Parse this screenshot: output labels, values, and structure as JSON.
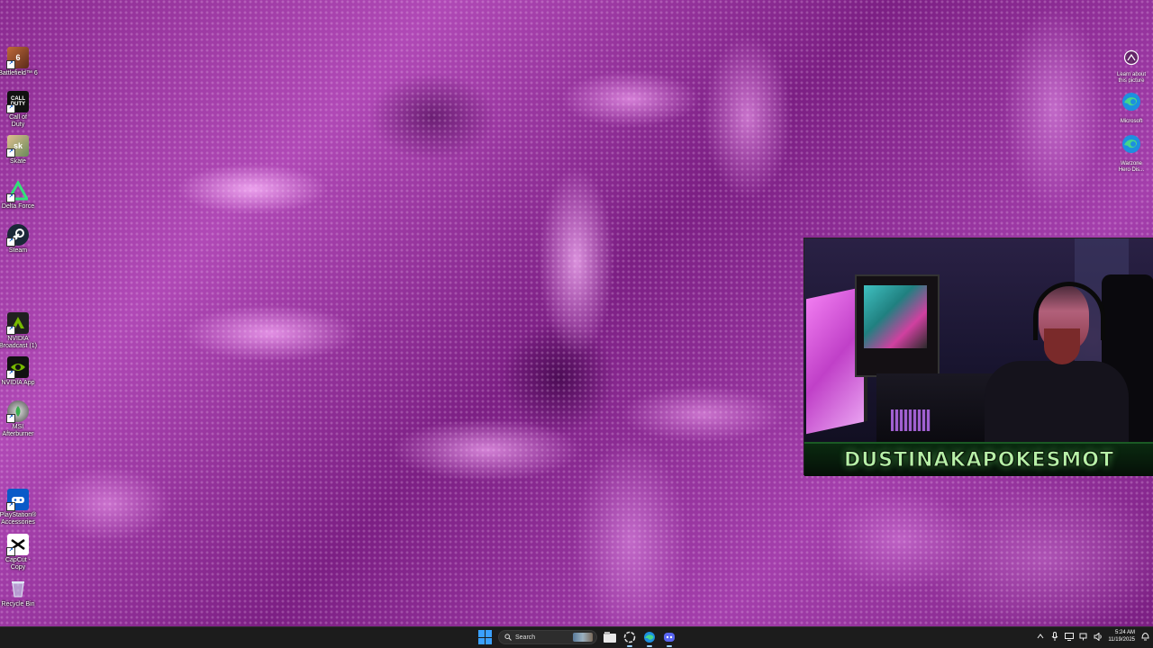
{
  "desktop_icons": [
    {
      "label": "Battlefield™ 6",
      "icon": "battlefield-icon",
      "color": "#8b4a2a"
    },
    {
      "label": "Call of\nDuty",
      "icon": "call-of-duty-icon",
      "color": "#111111"
    },
    {
      "label": "Skate",
      "icon": "skate-icon",
      "color": "#c09a6a"
    },
    {
      "label": "Delta Force",
      "icon": "delta-force-icon",
      "color": "#1a3a1a"
    },
    {
      "label": "Steam",
      "icon": "steam-icon",
      "color": "#1b2838"
    },
    {
      "label": "NVIDIA\nBroadcast (1)",
      "icon": "nvidia-broadcast-icon",
      "color": "#2a2a2a"
    },
    {
      "label": "NVIDIA App",
      "icon": "nvidia-app-icon",
      "color": "#1a1a1a"
    },
    {
      "label": "MSI\nAfterburner",
      "icon": "msi-afterburner-icon",
      "color": "#2a2a2a"
    },
    {
      "label": "PlayStation®\nAccessories",
      "icon": "playstation-accessories-icon",
      "color": "#0a4aa0"
    },
    {
      "label": "CapCut -\nCopy",
      "icon": "capcut-icon",
      "color": "#ffffff"
    },
    {
      "label": "Recycle Bin",
      "icon": "recycle-bin-icon",
      "color": "#9ab0c8"
    }
  ],
  "right_icons": [
    {
      "label": "Learn about\nthis picture",
      "icon": "learn-about-picture-icon"
    },
    {
      "label": "Microsoft",
      "icon": "microsoft-edge-icon"
    },
    {
      "label": "Warzone\nHero Dis...",
      "icon": "edge-shortcut-icon"
    }
  ],
  "camera": {
    "banner_text": "DUSTINAKAPOKESMOT"
  },
  "taskbar": {
    "search_label": "Search",
    "apps": [
      {
        "name": "file-explorer-icon",
        "label": "File Explorer"
      },
      {
        "name": "chatgpt-icon",
        "label": "ChatGPT"
      },
      {
        "name": "edge-icon",
        "label": "Microsoft Edge"
      },
      {
        "name": "discord-icon",
        "label": "Discord"
      }
    ],
    "time": "5:24 AM",
    "date": "11/19/2025"
  },
  "colors": {
    "accent": "#3aa0ff",
    "banner_text": "#b8f0a8",
    "wallpaper": "#a43fac"
  }
}
